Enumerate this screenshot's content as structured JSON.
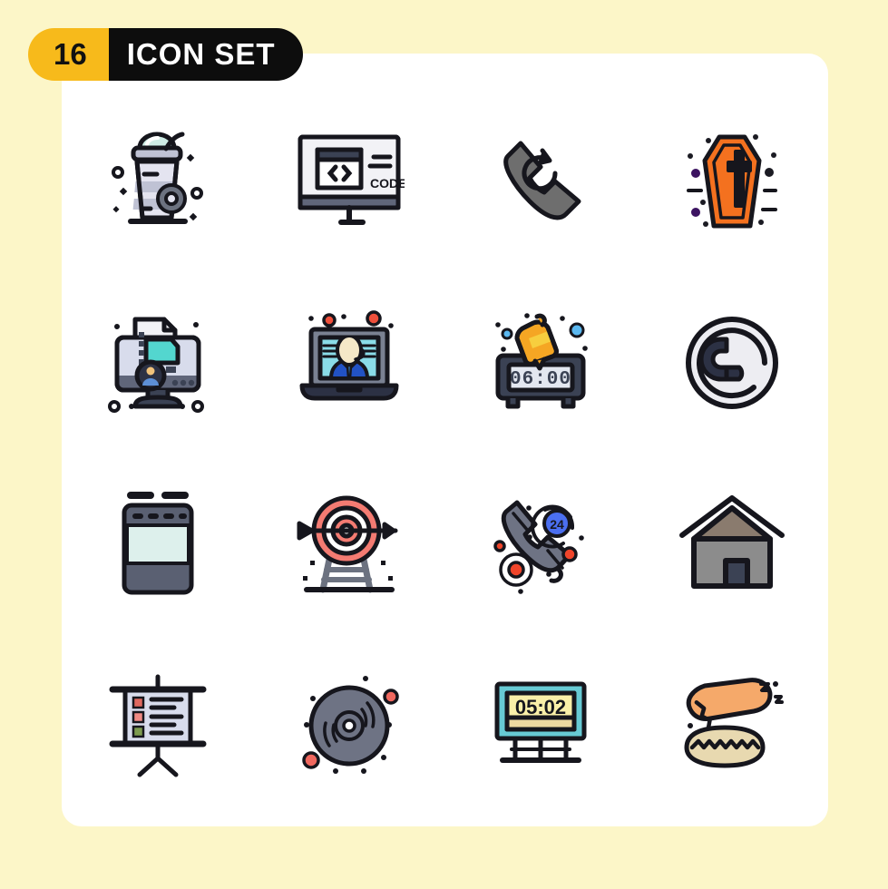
{
  "header": {
    "count": "16",
    "title": "ICON SET"
  },
  "theme": {
    "page_background": "#FCF6C8",
    "card_background": "#FFFFFF",
    "badge_count_background": "#F7BA1B",
    "badge_title_background": "#0D0D0D",
    "badge_title_color": "#FFFFFF",
    "outline": "#16161D"
  },
  "grid": {
    "columns": 4,
    "rows": 4,
    "total": 16
  },
  "icons": [
    {
      "index": 1,
      "name": "smoothie-cup-icon",
      "label": "Smoothie",
      "row": 1,
      "col": 1,
      "colors": {
        "dome": "#CFEDE6",
        "cup": "#E4E4F0",
        "band": "#BFC2D4",
        "dark": "#6C7280"
      }
    },
    {
      "index": 2,
      "name": "code-monitor-icon",
      "label": "Code",
      "row": 1,
      "col": 2,
      "text": "CODE",
      "colors": {
        "screen": "#F2F2F6",
        "bar": "#3B4254",
        "base": "#60667A"
      }
    },
    {
      "index": 3,
      "name": "phone-redial-icon",
      "label": "Redial",
      "row": 1,
      "col": 3,
      "colors": {
        "handset": "#6E6E6E"
      }
    },
    {
      "index": 4,
      "name": "coffin-cross-icon",
      "label": "Coffin",
      "row": 1,
      "col": 4,
      "colors": {
        "body": "#F4711F",
        "dot_purple": "#3C1361",
        "dot_dark": "#1B1B23"
      }
    },
    {
      "index": 5,
      "name": "blog-computer-icon",
      "label": "Blog",
      "row": 2,
      "col": 1,
      "colors": {
        "screen": "#D8DCEC",
        "chat": "#53D6CF",
        "paper": "#F2F2F6",
        "stand": "#3B4254",
        "avatar": "#2C3144"
      }
    },
    {
      "index": 6,
      "name": "laptop-support-agent-icon",
      "label": "Online Support",
      "row": 2,
      "col": 2,
      "colors": {
        "screen": "#8ADCE8",
        "suit": "#2252C4",
        "face": "#F5E8C8",
        "body": "#7A8192",
        "dot_red": "#F0503C"
      }
    },
    {
      "index": 7,
      "name": "alarm-clock-bell-icon",
      "label": "Alarm",
      "row": 2,
      "col": 3,
      "text": "06:00",
      "colors": {
        "case": "#3B4254",
        "display": "#E3E7F0",
        "bell": "#F5A623",
        "bell_light": "#F7CE3E",
        "dot_blue": "#5BB8F0"
      }
    },
    {
      "index": 8,
      "name": "phone-call-circle-icon",
      "label": "Call",
      "row": 2,
      "col": 4,
      "colors": {
        "fill": "#EDEDF2",
        "handset": "#2C3144"
      }
    },
    {
      "index": 9,
      "name": "tablet-device-icon",
      "label": "Device",
      "row": 3,
      "col": 1,
      "colors": {
        "body": "#5A6072",
        "screen": "#DDF0EC"
      }
    },
    {
      "index": 10,
      "name": "target-arrow-icon",
      "label": "Target",
      "row": 3,
      "col": 2,
      "colors": {
        "ring": "#F47B72",
        "white": "#FFFFFF",
        "stand": "#6C7280"
      }
    },
    {
      "index": 11,
      "name": "phone-24-hour-support-icon",
      "label": "24 Hour Support",
      "row": 3,
      "col": 3,
      "text": "24",
      "colors": {
        "handset": "#6E7384",
        "badge": "#4B6FF0",
        "dot_red": "#F0452B"
      }
    },
    {
      "index": 12,
      "name": "house-home-icon",
      "label": "Home",
      "row": 3,
      "col": 4,
      "colors": {
        "wall": "#8C8C8C",
        "roof": "#8A7B6E",
        "door": "#3B4254"
      }
    },
    {
      "index": 13,
      "name": "presentation-board-icon",
      "label": "Presentation",
      "row": 4,
      "col": 1,
      "colors": {
        "board": "#D8DCEC",
        "sq_red": "#E0685F",
        "sq_pink": "#F08A84",
        "sq_green": "#7D9B4E"
      }
    },
    {
      "index": 14,
      "name": "vinyl-record-icon",
      "label": "Record",
      "row": 4,
      "col": 2,
      "colors": {
        "disc": "#6E7384",
        "dot_red": "#F0685F"
      }
    },
    {
      "index": 15,
      "name": "scoreboard-icon",
      "label": "Scoreboard",
      "row": 4,
      "col": 3,
      "text": "05:02",
      "colors": {
        "frame": "#67CAD4",
        "display": "#FAEFA8",
        "strip": "#EDD9A0"
      }
    },
    {
      "index": 16,
      "name": "bread-loaf-icon",
      "label": "Bread",
      "row": 4,
      "col": 4,
      "colors": {
        "top": "#F5A96A",
        "bottom": "#E8D9B0"
      }
    }
  ]
}
